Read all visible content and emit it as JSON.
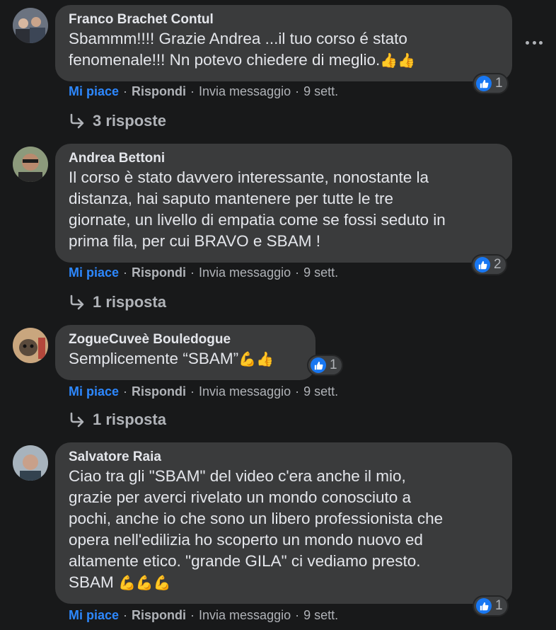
{
  "comments": [
    {
      "author": "Franco Brachet Contul",
      "text": "Sbammm!!!! Grazie Andrea ...il tuo corso é stato\nfenomenale!!! Nn potevo chiedere di meglio.",
      "emoji": "👍👍",
      "reactions": "1",
      "like_label": "Mi piace",
      "reply_label": "Rispondi",
      "message_label": "Invia messaggio",
      "time": "9 sett.",
      "replies_label": "3 risposte"
    },
    {
      "author": "Andrea Bettoni",
      "text": "Il corso è stato davvero interessante, nonostante la\ndistanza, hai saputo mantenere per tutte le tre\ngiornate, un livello di empatia come se fossi seduto in\nprima fila, per cui BRAVO e SBAM !",
      "emoji": "",
      "reactions": "2",
      "like_label": "Mi piace",
      "reply_label": "Rispondi",
      "message_label": "Invia messaggio",
      "time": "9 sett.",
      "replies_label": "1 risposta"
    },
    {
      "author": "ZogueCuveè Bouledogue",
      "text": "Semplicemente “SBAM”",
      "emoji": "💪👍",
      "reactions": "1",
      "like_label": "Mi piace",
      "reply_label": "Rispondi",
      "message_label": "Invia messaggio",
      "time": "9 sett.",
      "replies_label": "1 risposta"
    },
    {
      "author": "Salvatore Raia",
      "text": "Ciao tra gli \"SBAM\" del video c'era anche il mio,\ngrazie per averci rivelato un mondo conosciuto a\npochi, anche io che sono un libero professionista che\nopera nell'edilizia ho scoperto un mondo nuovo ed\naltamente etico. \"grande GILA\" ci vediamo presto.\nSBAM",
      "emoji": "💪💪💪",
      "reactions": "1",
      "like_label": "Mi piace",
      "reply_label": "Rispondi",
      "message_label": "Invia messaggio",
      "time": "9 sett."
    }
  ],
  "separator": "·",
  "colors": {
    "like_blue": "#2d88ff",
    "bubble": "#3a3b3c",
    "background": "#18191a"
  },
  "icons": {
    "more": "more-options-icon",
    "like": "like-thumb-icon",
    "reply_arrow": "reply-arrow-icon"
  }
}
